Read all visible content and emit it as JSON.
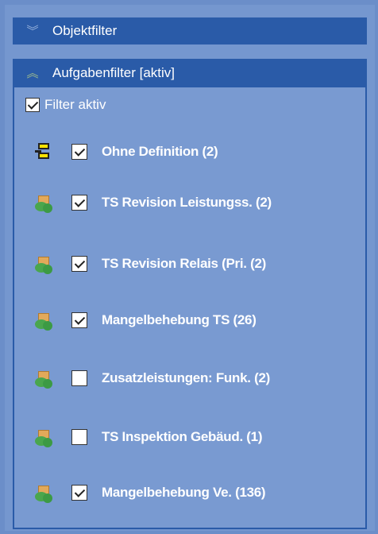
{
  "objektfilter": {
    "title": "Objektfilter"
  },
  "aufgabenfilter": {
    "title": "Aufgabenfilter [aktiv]",
    "filter_active_label": "Filter aktiv",
    "items": [
      {
        "label": "Ohne Definition (2)",
        "checked": true,
        "icon": "definition-icon"
      },
      {
        "label": "TS Revision Leistungss. (2)",
        "checked": true,
        "icon": "task-icon"
      },
      {
        "label": "TS Revision Relais (Pri. (2)",
        "checked": true,
        "icon": "task-icon"
      },
      {
        "label": "Mangelbehebung TS (26)",
        "checked": true,
        "icon": "task-icon"
      },
      {
        "label": "Zusatzleistungen: Funk. (2)",
        "checked": false,
        "icon": "task-icon"
      },
      {
        "label": "TS Inspektion Gebäud. (1)",
        "checked": false,
        "icon": "task-icon"
      },
      {
        "label": "Mangelbehebung Ve. (136)",
        "checked": true,
        "icon": "task-icon"
      }
    ]
  }
}
